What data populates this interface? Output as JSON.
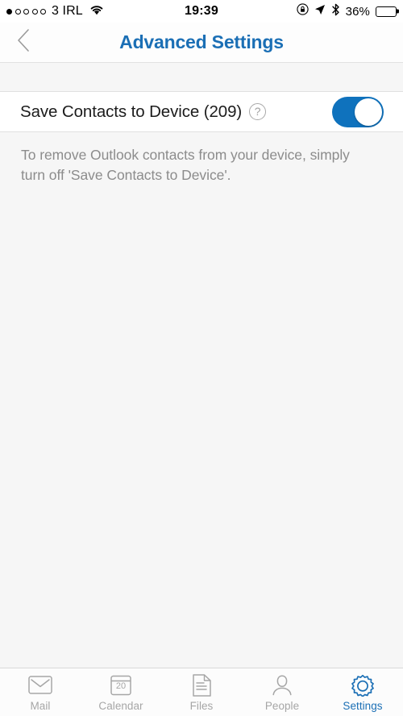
{
  "status_bar": {
    "signal_dots_total": 5,
    "signal_dots_filled": 1,
    "carrier": "3 IRL",
    "wifi_icon": "wifi-icon",
    "time": "19:39",
    "rotation_lock_icon": "rotation-lock-icon",
    "location_icon": "location-arrow-icon",
    "bluetooth_icon": "bluetooth-icon",
    "battery_percent": "36%",
    "battery_level": 36
  },
  "nav_bar": {
    "back_icon": "chevron-left-icon",
    "title": "Advanced Settings",
    "title_color": "#1b6fb5"
  },
  "settings": {
    "row": {
      "label": "Save Contacts to Device (209)",
      "help_icon": "question-mark-circle-icon",
      "toggle_state": "on",
      "toggle_on_color": "#0f72bd"
    },
    "footer_note": "To remove Outlook contacts from your device, simply turn off 'Save Contacts to Device'."
  },
  "tab_bar": {
    "active_color": "#1b6fb5",
    "inactive_color": "#a6a6a6",
    "items": [
      {
        "label": "Mail",
        "icon": "envelope-icon",
        "active": false
      },
      {
        "label": "Calendar",
        "icon": "calendar-icon",
        "day": "20",
        "active": false
      },
      {
        "label": "Files",
        "icon": "document-icon",
        "active": false
      },
      {
        "label": "People",
        "icon": "person-icon",
        "active": false
      },
      {
        "label": "Settings",
        "icon": "gear-icon",
        "active": true
      }
    ]
  }
}
